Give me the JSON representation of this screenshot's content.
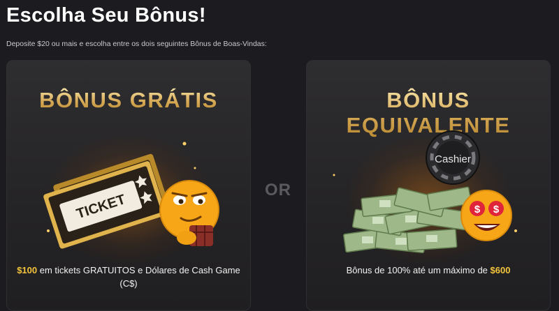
{
  "page": {
    "title": "Escolha Seu Bônus!",
    "subtitle": "Deposite $20 ou mais e escolha entre os dois seguintes Bônus de Boas-Vindas:",
    "or_label": "OR"
  },
  "cards": [
    {
      "title": "BÔNUS GRÁTIS",
      "image_text": "TICKET",
      "desc_amount": "$100",
      "desc_text": " em tickets GRATUITOS e Dólares de Cash Game (C$)"
    },
    {
      "title": "BÔNUS EQUIVALENTE",
      "image_text": "Cashier",
      "desc_text": "Bônus de 100% até um máximo de ",
      "desc_amount": "$600"
    }
  ],
  "colors": {
    "background": "#1c1c20",
    "gold_title": "#d9b066",
    "gold_highlight": "#f3c43c",
    "or_text": "#5a5a5e"
  }
}
